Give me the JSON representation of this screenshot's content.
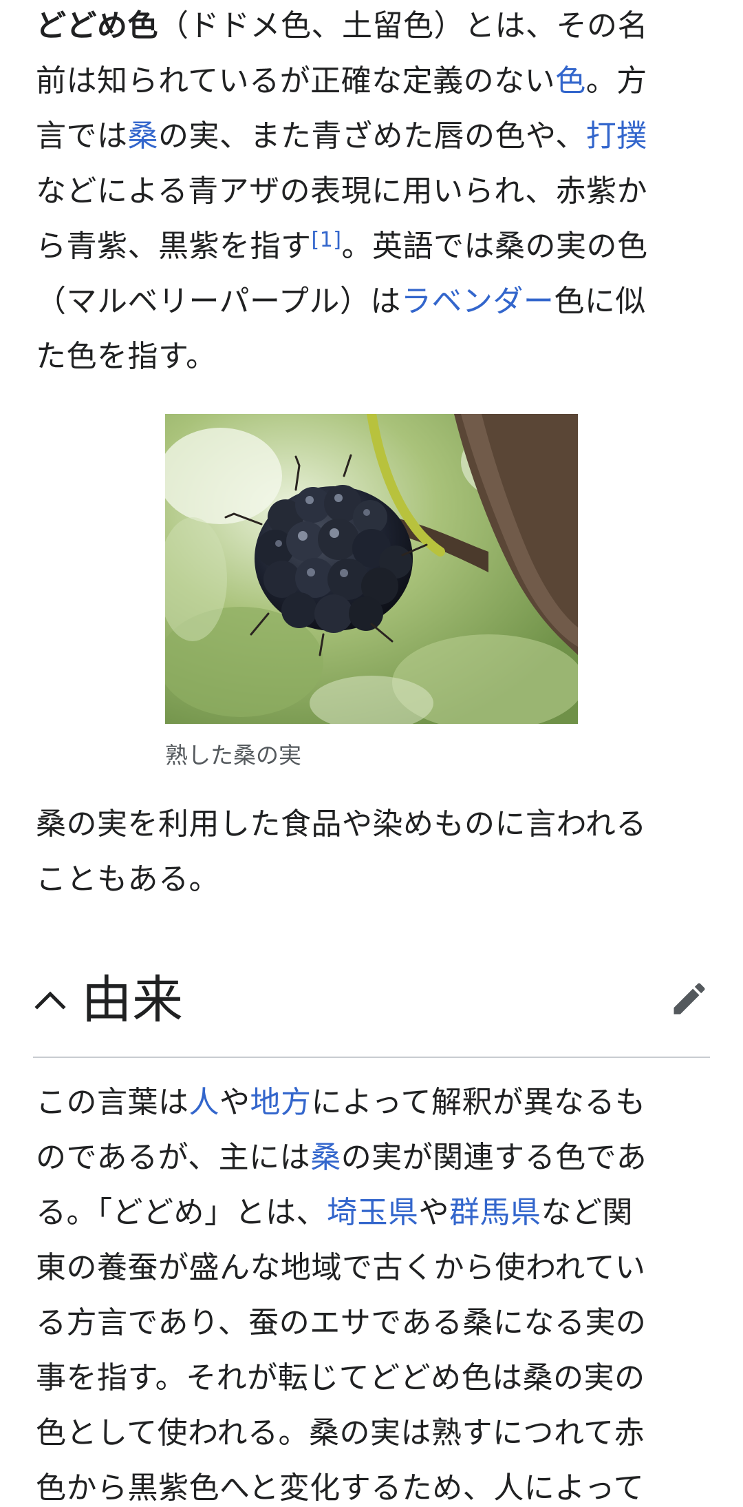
{
  "intro": {
    "term_bold": "どどめ色",
    "alt_names": "（ドドメ色、土留色）とは、その名",
    "line2_pre": "前は知られているが正確な定義のない",
    "line2_link": "色",
    "line2_post": "。方",
    "line3_pre": "言では",
    "line3_link1": "桑",
    "line3_mid": "の実、また青ざめた唇の色や、",
    "line3_link2": "打撲",
    "line4": "などによる青アザの表現に用いられ、赤紫か",
    "line5_pre": "ら青紫、黒紫を指す",
    "line5_ref": "[1]",
    "line5_post": "。英語では桑の実の色",
    "line6_pre": "（マルベリーパープル）は",
    "line6_link": "ラベンダー",
    "line6_post": "色に似",
    "line7": "た色を指す。"
  },
  "figure": {
    "caption": "熟した桑の実",
    "image_icon": "mulberry-photo"
  },
  "after_figure": {
    "line1": "桑の実を利用した食品や染めものに言われる",
    "line2": "こともある。"
  },
  "section": {
    "title": "由来",
    "collapse_icon": "chevron-up-icon",
    "edit_icon": "pencil-icon"
  },
  "origin": {
    "line1_pre": "この言葉は",
    "line1_link1": "人",
    "line1_mid": "や",
    "line1_link2": "地方",
    "line1_post": "によって解釈が異なるも",
    "line2_pre": "のであるが、主には",
    "line2_link": "桑",
    "line2_post": "の実が関連する色であ",
    "line3_pre": "る。「どどめ」とは、",
    "line3_link1": "埼玉県",
    "line3_mid": "や",
    "line3_link2": "群馬県",
    "line3_post": "など関",
    "line4": "東の養蚕が盛んな地域で古くから使われてい",
    "line5": "る方言であり、蚕のエサである桑になる実の",
    "line6": "事を指す。それが転じてどどめ色は桑の実の",
    "line7": "色として使われる。桑の実は熟すにつれて赤",
    "line8": "色から黒紫色へと変化するため、人によって"
  },
  "colors": {
    "link": "#3366cc",
    "text": "#202122",
    "caption": "#54595d",
    "divider": "#c8ccd1"
  }
}
